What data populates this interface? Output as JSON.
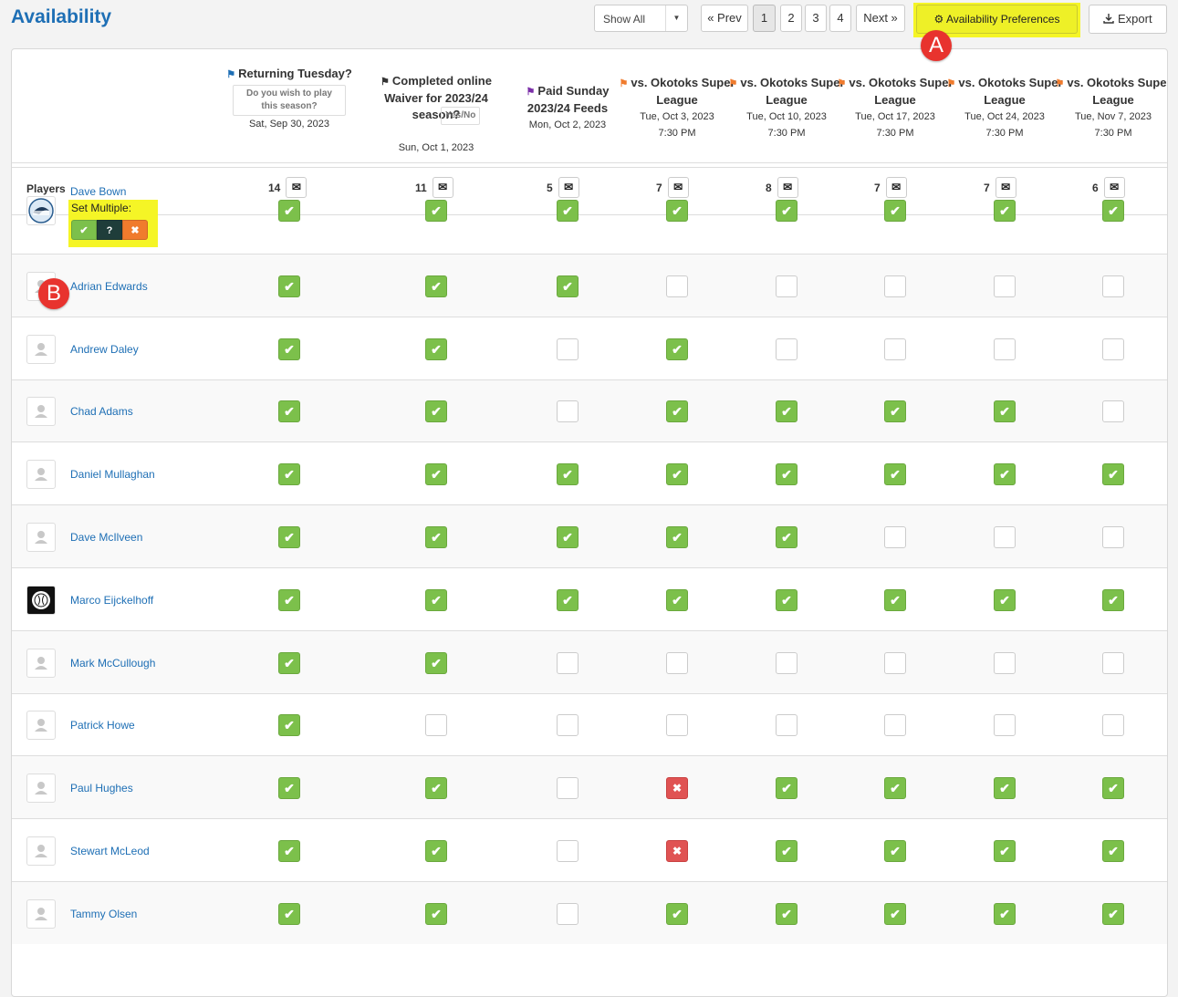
{
  "page": {
    "title": "Availability"
  },
  "toolbar": {
    "filter_value": "Show All",
    "prev_label": "« Prev",
    "pages": [
      "1",
      "2",
      "3",
      "4"
    ],
    "active_page": "1",
    "next_label": "Next »",
    "preferences_label": "Availability Preferences",
    "export_label": "Export"
  },
  "callouts": {
    "a": "A",
    "b": "B"
  },
  "columns": [
    {
      "title": "Returning Tuesday?",
      "flag_color": "#1e6fb5",
      "question": "Do you wish to play this season?",
      "date": "Sat, Sep 30, 2023",
      "time": "",
      "count": "14"
    },
    {
      "title": "Completed online Waiver for 2023/24 season?",
      "flag_color": "#333333",
      "question": "Yes/No",
      "date": "Sun, Oct 1, 2023",
      "time": "",
      "count": "11"
    },
    {
      "title": "Paid Sunday 2023/24 Feeds",
      "flag_color": "#7b2fa8",
      "question": "",
      "date": "Mon, Oct 2, 2023",
      "time": "",
      "count": "5"
    },
    {
      "title": "vs. Okotoks Super League",
      "flag_color": "#f07b2d",
      "question": "",
      "date": "Tue, Oct 3, 2023",
      "time": "7:30 PM",
      "count": "7"
    },
    {
      "title": "vs. Okotoks Super League",
      "flag_color": "#f07b2d",
      "question": "",
      "date": "Tue, Oct 10, 2023",
      "time": "7:30 PM",
      "count": "8"
    },
    {
      "title": "vs. Okotoks Super League",
      "flag_color": "#f07b2d",
      "question": "",
      "date": "Tue, Oct 17, 2023",
      "time": "7:30 PM",
      "count": "7"
    },
    {
      "title": "vs. Okotoks Super League",
      "flag_color": "#f07b2d",
      "question": "",
      "date": "Tue, Oct 24, 2023",
      "time": "7:30 PM",
      "count": "7"
    },
    {
      "title": "vs. Okotoks Super League",
      "flag_color": "#f07b2d",
      "question": "",
      "date": "Tue, Nov 7, 2023",
      "time": "7:30 PM",
      "count": "6"
    }
  ],
  "players_label": "Players",
  "set_multiple": {
    "label": "Set Multiple:",
    "yes": "✔",
    "maybe": "?",
    "no": "✖"
  },
  "players": [
    {
      "name": "Dave Bown",
      "avatar": "orcas-logo",
      "status": [
        "yes",
        "yes",
        "yes",
        "yes",
        "yes",
        "yes",
        "yes",
        "yes"
      ]
    },
    {
      "name": "Adrian Edwards",
      "avatar": "default-user",
      "status": [
        "yes",
        "yes",
        "yes",
        "empty",
        "empty",
        "empty",
        "empty",
        "empty"
      ]
    },
    {
      "name": "Andrew Daley",
      "avatar": "default-user",
      "status": [
        "yes",
        "yes",
        "empty",
        "yes",
        "empty",
        "empty",
        "empty",
        "empty"
      ]
    },
    {
      "name": "Chad Adams",
      "avatar": "default-user",
      "status": [
        "yes",
        "yes",
        "empty",
        "yes",
        "yes",
        "yes",
        "yes",
        "empty"
      ]
    },
    {
      "name": "Daniel Mullaghan",
      "avatar": "default-user",
      "status": [
        "yes",
        "yes",
        "yes",
        "yes",
        "yes",
        "yes",
        "yes",
        "yes"
      ]
    },
    {
      "name": "Dave McIlveen",
      "avatar": "default-user",
      "status": [
        "yes",
        "yes",
        "yes",
        "yes",
        "yes",
        "empty",
        "empty",
        "empty"
      ]
    },
    {
      "name": "Marco Eijckelhoff",
      "avatar": "ajax-logo",
      "status": [
        "yes",
        "yes",
        "yes",
        "yes",
        "yes",
        "yes",
        "yes",
        "yes"
      ]
    },
    {
      "name": "Mark McCullough",
      "avatar": "default-user",
      "status": [
        "yes",
        "yes",
        "empty",
        "empty",
        "empty",
        "empty",
        "empty",
        "empty"
      ]
    },
    {
      "name": "Patrick Howe",
      "avatar": "default-user",
      "status": [
        "yes",
        "empty",
        "empty",
        "empty",
        "empty",
        "empty",
        "empty",
        "empty"
      ]
    },
    {
      "name": "Paul Hughes",
      "avatar": "default-user",
      "status": [
        "yes",
        "yes",
        "empty",
        "no",
        "yes",
        "yes",
        "yes",
        "yes"
      ]
    },
    {
      "name": "Stewart McLeod",
      "avatar": "default-user",
      "status": [
        "yes",
        "yes",
        "empty",
        "no",
        "yes",
        "yes",
        "yes",
        "yes"
      ]
    },
    {
      "name": "Tammy Olsen",
      "avatar": "default-user",
      "status": [
        "yes",
        "yes",
        "empty",
        "yes",
        "yes",
        "yes",
        "yes",
        "yes"
      ]
    }
  ],
  "icons": {
    "check": "✔",
    "cross": "✖",
    "mail": "✉",
    "gear": "⚙",
    "flag": "⚑"
  }
}
